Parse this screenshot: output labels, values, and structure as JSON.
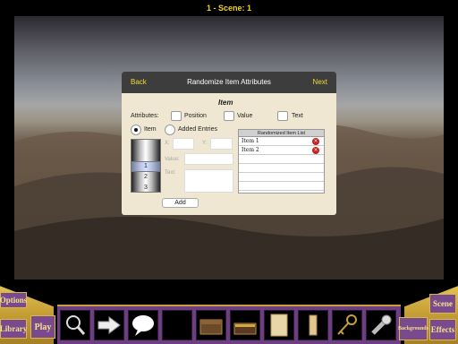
{
  "header": {
    "title": "1 - Scene: 1"
  },
  "dialog": {
    "back_label": "Back",
    "title": "Randomize Item Attributes",
    "next_label": "Next",
    "section_title": "Item",
    "attributes_label": "Attributes:",
    "attributes": [
      {
        "label": "Position",
        "checked": false
      },
      {
        "label": "Value",
        "checked": false
      },
      {
        "label": "Text",
        "checked": false
      }
    ],
    "source_options": [
      {
        "label": "Item",
        "selected": true
      },
      {
        "label": "Added Entries",
        "selected": false
      }
    ],
    "picker": {
      "values": [
        "1",
        "2",
        "3"
      ],
      "selected": "1"
    },
    "x_label": "X:",
    "y_label": "Y:",
    "value_label": "Value:",
    "text_label": "Text:",
    "x_value": "",
    "y_value": "",
    "value_value": "",
    "text_value": "",
    "add_label": "Add",
    "list_title": "Randomized Item List",
    "list_items": [
      "Item 1",
      "Item 2"
    ]
  },
  "bottom_bar": {
    "options_label": "Options",
    "library_label": "Library",
    "play_label": "Play",
    "backgrounds_label": "Backgrounds",
    "scene_label": "Scene",
    "effects_label": "Effects",
    "tools": [
      "magnifier-icon",
      "arrow-icon",
      "speech-bubble-icon",
      "empty-slot",
      "chest-icon",
      "open-chest-icon",
      "parchment-icon",
      "scroll-icon",
      "keys-icon",
      "flashlight-icon"
    ]
  },
  "colors": {
    "accent_yellow": "#f1dc32",
    "toolbar_purple": "#6d3f82",
    "gold": "#c8a037",
    "delete_red": "#c8201b"
  }
}
